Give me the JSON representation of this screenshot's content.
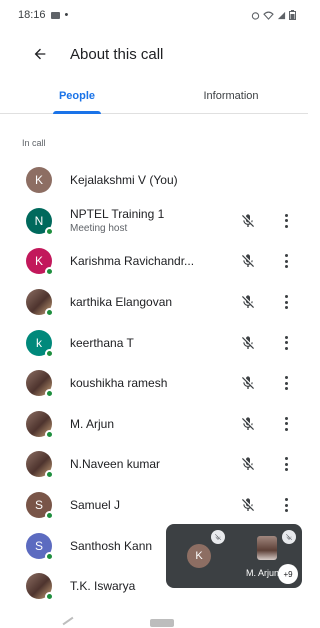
{
  "status_bar": {
    "time": "18:16",
    "dot": "•"
  },
  "header": {
    "title": "About this call"
  },
  "tabs": [
    {
      "label": "People",
      "active": true
    },
    {
      "label": "Information",
      "active": false
    }
  ],
  "section_label": "In call",
  "participants": [
    {
      "name": "Kejalakshmi V (You)",
      "subtitle": "",
      "initial": "K",
      "avatar_color": "#8d6e63",
      "photo": false,
      "presence": false,
      "controls": false
    },
    {
      "name": "NPTEL Training 1",
      "subtitle": "Meeting host",
      "initial": "N",
      "avatar_color": "#00695c",
      "photo": false,
      "presence": true,
      "controls": true
    },
    {
      "name": "Karishma Ravichandr...",
      "subtitle": "",
      "initial": "K",
      "avatar_color": "#c2185b",
      "photo": false,
      "presence": true,
      "controls": true
    },
    {
      "name": "karthika Elangovan",
      "subtitle": "",
      "initial": "",
      "avatar_color": "#d98ca0",
      "photo": true,
      "presence": true,
      "controls": true
    },
    {
      "name": "keerthana T",
      "subtitle": "",
      "initial": "k",
      "avatar_color": "#00897b",
      "photo": false,
      "presence": true,
      "controls": true
    },
    {
      "name": "koushikha ramesh",
      "subtitle": "",
      "initial": "",
      "avatar_color": "#6d5a4a",
      "photo": true,
      "presence": true,
      "controls": true
    },
    {
      "name": "M. Arjun",
      "subtitle": "",
      "initial": "",
      "avatar_color": "#5d4037",
      "photo": true,
      "presence": true,
      "controls": true
    },
    {
      "name": "N.Naveen kumar",
      "subtitle": "",
      "initial": "",
      "avatar_color": "#6f8fae",
      "photo": true,
      "presence": true,
      "controls": true
    },
    {
      "name": "Samuel J",
      "subtitle": "",
      "initial": "S",
      "avatar_color": "#795548",
      "photo": false,
      "presence": true,
      "controls": true
    },
    {
      "name": "Santhosh Kann",
      "subtitle": "",
      "initial": "S",
      "avatar_color": "#5c6bc0",
      "photo": false,
      "presence": true,
      "controls": false
    },
    {
      "name": "T.K. Iswarya",
      "subtitle": "",
      "initial": "",
      "avatar_color": "#c62828",
      "photo": true,
      "presence": true,
      "controls": false
    }
  ],
  "pip": {
    "tile1_initial": "K",
    "tile2_name": "M. Arjun",
    "more_count": "+9"
  },
  "icons": {
    "back": "arrow-back-icon",
    "mic": "mic-off-icon",
    "more": "more-vert-icon"
  },
  "colors": {
    "accent": "#1a73e8",
    "presence": "#1e8e3e"
  }
}
